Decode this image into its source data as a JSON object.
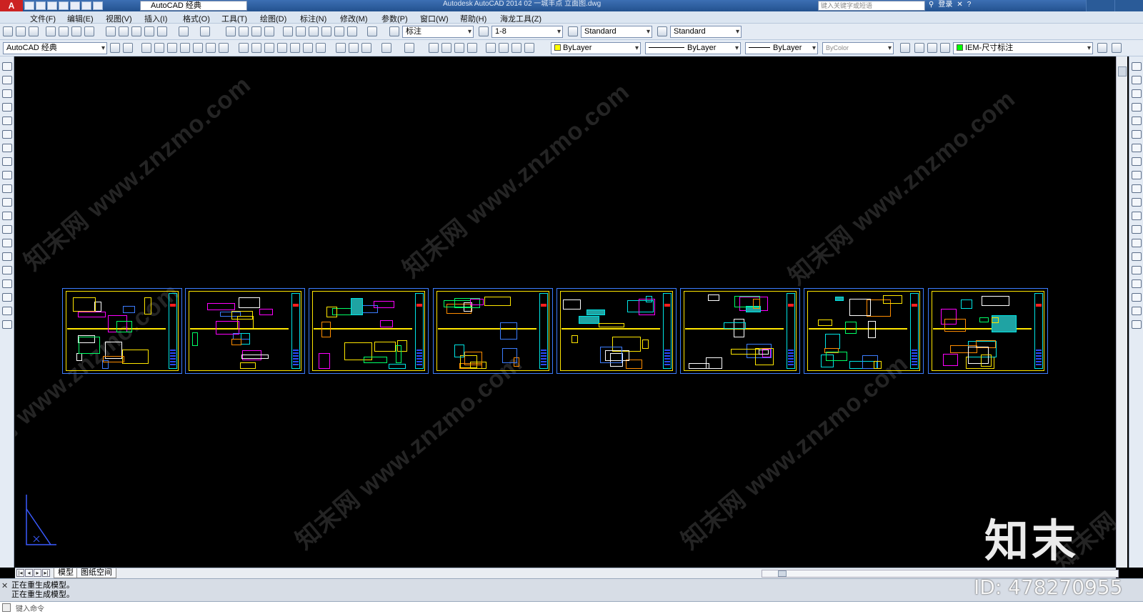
{
  "titlebar": {
    "app_icon": "A",
    "workspace": "AutoCAD 经典",
    "title": "Autodesk AutoCAD 2014    02 一城丰点 立面图.dwg",
    "search_placeholder": "键入关键字或短语",
    "login": "登录"
  },
  "menu": [
    "文件(F)",
    "编辑(E)",
    "视图(V)",
    "插入(I)",
    "格式(O)",
    "工具(T)",
    "绘图(D)",
    "标注(N)",
    "修改(M)",
    "参数(P)",
    "窗口(W)",
    "帮助(H)",
    "海龙工具(Z)"
  ],
  "toolbar1": {
    "text_style": "标注",
    "dim_scale": "1-8",
    "table_style": "Standard",
    "multileader_style": "Standard"
  },
  "toolbar2": {
    "workspace": "AutoCAD 经典",
    "color": "ByLayer",
    "linetype": "ByLayer",
    "lineweight": "ByLayer",
    "plotstyle": "ByColor",
    "layer": "IEM-尺寸标注",
    "color_hex": "#ffff00"
  },
  "watermark": {
    "text": "知末网 www.znzmo.com"
  },
  "brand": "知末",
  "drawing_id": "ID: 478270955",
  "tabs": {
    "model": "模型",
    "layout": "图纸空间"
  },
  "command": {
    "history": [
      "正在重生成模型。",
      "正在重生成模型。"
    ],
    "placeholder": "键入命令"
  }
}
